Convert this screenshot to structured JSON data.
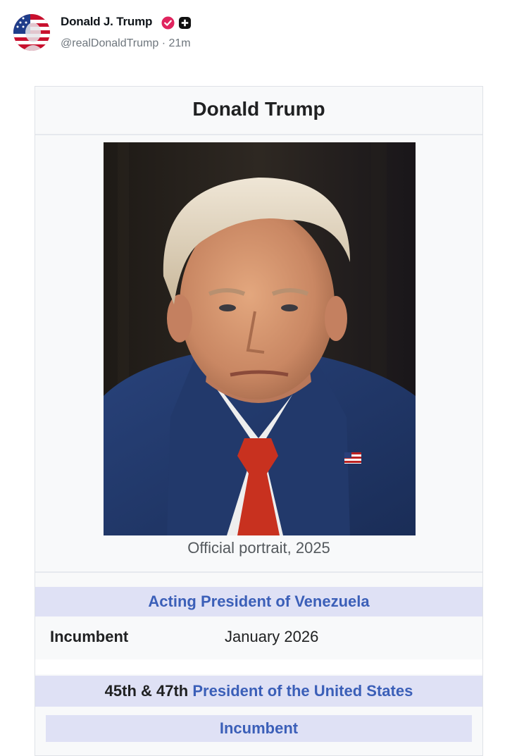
{
  "post": {
    "author_name": "Donald J. Trump",
    "handle_time": "@realDonaldTrump · 21m",
    "avatar_icon": "flag-portrait-avatar",
    "verified_icon": "verified-badge-icon",
    "badge_icon": "plus-badge-icon",
    "verified_color": "#e0245e"
  },
  "infobox": {
    "title": "Donald Trump",
    "image_caption": "Official portrait, 2025",
    "office1_title": "Acting President of Venezuela",
    "office1_row_label": "Incumbent",
    "office1_row_value": "January 2026",
    "office2_prefix": "45th & 47th",
    "office2_title": "President of the United States",
    "office2_status": "Incumbent",
    "link_color": "#3b5fb8",
    "header_bg": "#dfe1f5"
  }
}
